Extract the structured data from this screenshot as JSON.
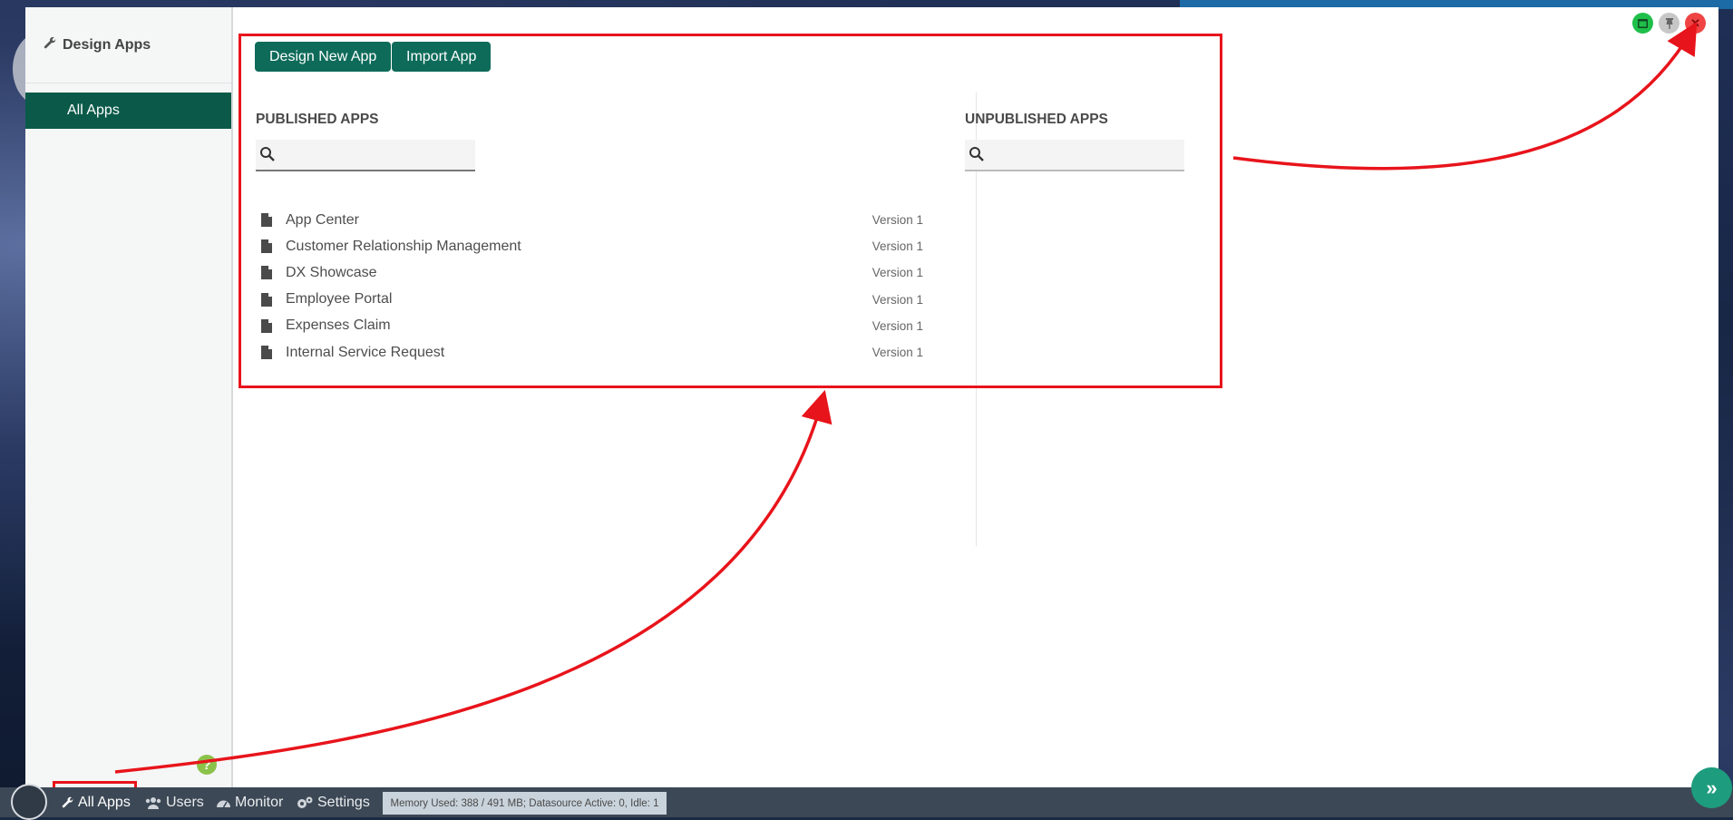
{
  "sidebar": {
    "title": "Design Apps",
    "items": [
      {
        "label": "All Apps"
      }
    ]
  },
  "toolbar": {
    "design_new_label": "Design New App",
    "import_label": "Import App"
  },
  "published": {
    "title": "PUBLISHED APPS",
    "search_placeholder": "",
    "apps": [
      {
        "name": "App Center",
        "version": "Version 1"
      },
      {
        "name": "Customer Relationship Management",
        "version": "Version 1"
      },
      {
        "name": "DX Showcase",
        "version": "Version 1"
      },
      {
        "name": "Employee Portal",
        "version": "Version 1"
      },
      {
        "name": "Expenses Claim",
        "version": "Version 1"
      },
      {
        "name": "Internal Service Request",
        "version": "Version 1"
      }
    ]
  },
  "unpublished": {
    "title": "UNPUBLISHED APPS",
    "search_placeholder": ""
  },
  "window_controls": {
    "minimize_icon": "window-icon",
    "pin_icon": "pin-icon",
    "close_icon": "close-icon",
    "colors": {
      "minimize": "#1fbf4a",
      "pin": "#c7c7c7",
      "close": "#f04444"
    }
  },
  "taskbar": {
    "items": [
      {
        "label": "All Apps",
        "icon": "wrench-icon"
      },
      {
        "label": "Users",
        "icon": "users-icon"
      },
      {
        "label": "Monitor",
        "icon": "dashboard-icon"
      },
      {
        "label": "Settings",
        "icon": "cogs-icon"
      }
    ],
    "status": "Memory Used: 388 / 491 MB; Datasource Active: 0, Idle: 1"
  },
  "colors": {
    "accent": "#0e6b5a",
    "annotation": "#e8141b",
    "taskbar": "#3c4855"
  }
}
